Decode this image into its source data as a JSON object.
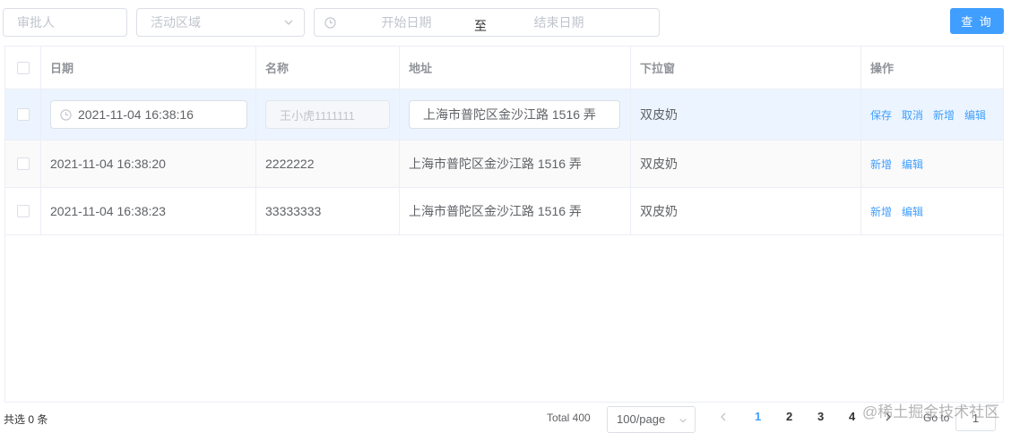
{
  "filters": {
    "approver_placeholder": "审批人",
    "region_placeholder": "活动区域",
    "start_date_placeholder": "开始日期",
    "range_separator": "至",
    "end_date_placeholder": "结束日期",
    "search_label": "查 询"
  },
  "table": {
    "columns": [
      "日期",
      "名称",
      "地址",
      "下拉窗",
      "操作"
    ],
    "rows": [
      {
        "date": "2021-11-04 16:38:16",
        "name": "王小虎1111111",
        "address": "上海市普陀区金沙江路 1516 弄",
        "dropdown": "双皮奶",
        "actions": [
          "保存",
          "取消",
          "新增",
          "编辑"
        ]
      },
      {
        "date": "2021-11-04 16:38:20",
        "name": "2222222",
        "address": "上海市普陀区金沙江路 1516 弄",
        "dropdown": "双皮奶",
        "actions": [
          "新增",
          "编辑"
        ]
      },
      {
        "date": "2021-11-04 16:38:23",
        "name": "33333333",
        "address": "上海市普陀区金沙江路 1516 弄",
        "dropdown": "双皮奶",
        "actions": [
          "新增",
          "编辑"
        ]
      }
    ]
  },
  "footer": {
    "selected": "共选 0 条",
    "total": "Total 400",
    "page_size": "100/page",
    "pages": [
      "1",
      "2",
      "3",
      "4"
    ],
    "current_page": "1",
    "goto_label": "Go to",
    "goto_value": "1"
  },
  "watermark": "@稀土掘金技术社区",
  "colors": {
    "primary": "#409eff",
    "editing_row": "#ecf5ff",
    "border": "#ebeef5"
  },
  "icons": [
    "clock-icon",
    "chevron-down-icon",
    "chevron-left-icon",
    "chevron-right-icon"
  ]
}
